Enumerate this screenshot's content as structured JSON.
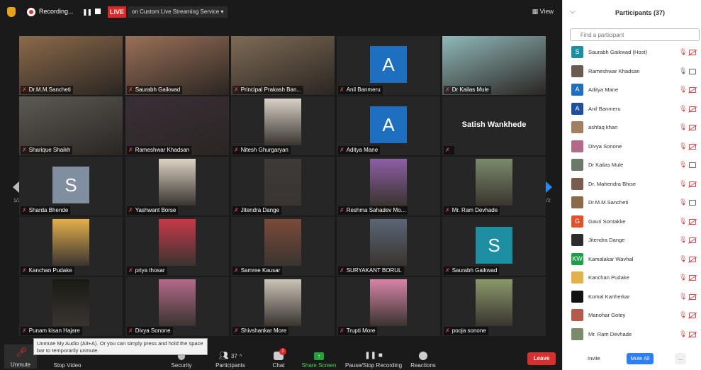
{
  "topbar": {
    "recording_label": "Recording...",
    "live_label": "LIVE",
    "live_destination": "on Custom Live Streaming Service",
    "view_label": "View"
  },
  "grid": {
    "page_indicator": "1/2",
    "tiles": [
      {
        "name": "Dr.M.M.Sancheti",
        "type": "video",
        "bg": "#8b6a4a"
      },
      {
        "name": "Saurabh Gaikwad",
        "type": "video",
        "bg": "#9a7058"
      },
      {
        "name": "Principal Prakash Ban...",
        "type": "video",
        "bg": "#7e6b55"
      },
      {
        "name": "Anil Banmeru",
        "type": "letter",
        "letter": "A",
        "color": "#1e6fbf"
      },
      {
        "name": "Dr Kailas Mule",
        "type": "video",
        "bg": "#8fb8b8"
      },
      {
        "name": "Sharique Shaikh",
        "type": "video",
        "bg": "#5c5a55"
      },
      {
        "name": "Rameshwar Khadsan",
        "type": "video",
        "bg": "#3a2f38",
        "active": true
      },
      {
        "name": "Nitesh Ghurgaryan",
        "type": "photo",
        "bg": "#d9d2c8"
      },
      {
        "name": "Aditya Mane",
        "type": "letter",
        "letter": "A",
        "color": "#1e6fbf"
      },
      {
        "name": "Satish Wankhede",
        "type": "text"
      },
      {
        "name": "Sharda Bhende",
        "type": "letter",
        "letter": "S",
        "color": "#7f8fa0"
      },
      {
        "name": "Yashwant Borse",
        "type": "photo",
        "bg": "#ddd3c5"
      },
      {
        "name": "Jitendra Dange",
        "type": "photo",
        "bg": "#3d3b3a"
      },
      {
        "name": "Reshma Sahadev Mo...",
        "type": "photo",
        "bg": "#8d5fa6"
      },
      {
        "name": "Mr. Ram Devhade",
        "type": "photo",
        "bg": "#7a8a6a"
      },
      {
        "name": "Kanchan Pudake",
        "type": "photo",
        "bg": "#e3b04a"
      },
      {
        "name": "priya thosar",
        "type": "photo",
        "bg": "#c8384a"
      },
      {
        "name": "Samree Kausar",
        "type": "photo",
        "bg": "#7b4a3a"
      },
      {
        "name": "SURYAKANT BORUL",
        "type": "photo",
        "bg": "#5a6575"
      },
      {
        "name": "Saurabh Gaikwad",
        "type": "letter",
        "letter": "S",
        "color": "#1d8fa3"
      },
      {
        "name": "Punam kisan Hajare",
        "type": "photo",
        "bg": "#1a1a14"
      },
      {
        "name": "Divya Sonone",
        "type": "photo",
        "bg": "#b36a8a"
      },
      {
        "name": "Shivshankar More",
        "type": "photo",
        "bg": "#c9c3b8"
      },
      {
        "name": "Trupti More",
        "type": "photo",
        "bg": "#d784a8"
      },
      {
        "name": "pooja sonone",
        "type": "photo",
        "bg": "#8a9a6a"
      }
    ]
  },
  "tooltip": {
    "text": "Unmute My Audio (Alt+A). Or you can simply press and hold the space bar to temporarily unmute."
  },
  "controls": {
    "unmute": "Unmute",
    "stop_video": "Stop Video",
    "security": "Security",
    "participants": "Participants",
    "participants_count": "37",
    "chat": "Chat",
    "chat_badge": "2",
    "share_screen": "Share Screen",
    "pause_stop_recording": "Pause/Stop Recording",
    "reactions": "Reactions",
    "leave": "Leave"
  },
  "panel": {
    "title": "Participants (37)",
    "search_placeholder": "Find a participant",
    "participants": [
      {
        "name": "Saurabh Gaikwad (Host)",
        "avatar": "S",
        "color": "#1d8fa3",
        "mic": "muted",
        "cam": "off"
      },
      {
        "name": "Rameshwar Khadsan",
        "avatar": "",
        "color": "#6a5a50",
        "mic": "on",
        "cam": "on"
      },
      {
        "name": "Aditya Mane",
        "avatar": "A",
        "color": "#1e6fbf",
        "mic": "muted",
        "cam": "off"
      },
      {
        "name": "Anil Banmeru",
        "avatar": "A",
        "color": "#1e4f9f",
        "mic": "muted",
        "cam": "off"
      },
      {
        "name": "ashfaq khan",
        "avatar": "",
        "color": "#a08060",
        "mic": "muted",
        "cam": "off"
      },
      {
        "name": "Divya Sonone",
        "avatar": "",
        "color": "#b36a8a",
        "mic": "muted",
        "cam": "off"
      },
      {
        "name": "Dr Kailas Mule",
        "avatar": "",
        "color": "#6a7a6a",
        "mic": "muted",
        "cam": "on"
      },
      {
        "name": "Dr. Mahendra Bhise",
        "avatar": "",
        "color": "#7a5a4a",
        "mic": "muted",
        "cam": "off"
      },
      {
        "name": "Dr.M.M.Sancheti",
        "avatar": "",
        "color": "#8b6a4a",
        "mic": "muted",
        "cam": "on"
      },
      {
        "name": "Gauri Sontakke",
        "avatar": "G",
        "color": "#e0522a",
        "mic": "muted",
        "cam": "off"
      },
      {
        "name": "Jitendra Dange",
        "avatar": "",
        "color": "#2d2d2d",
        "mic": "muted",
        "cam": "off"
      },
      {
        "name": "Kamalakar Wavhal",
        "avatar": "KW",
        "color": "#1f9e4a",
        "mic": "muted",
        "cam": "off"
      },
      {
        "name": "Kanchan Pudake",
        "avatar": "",
        "color": "#e3b04a",
        "mic": "muted",
        "cam": "off"
      },
      {
        "name": "Komal Kanherkar",
        "avatar": "",
        "color": "#111111",
        "mic": "muted",
        "cam": "off"
      },
      {
        "name": "Manohar Gotey",
        "avatar": "",
        "color": "#b35a4a",
        "mic": "muted",
        "cam": "off"
      },
      {
        "name": "Mr. Ram Devhade",
        "avatar": "",
        "color": "#7a8a6a",
        "mic": "muted",
        "cam": "off"
      }
    ],
    "invite": "Invite",
    "mute_all": "Mute All",
    "more": "..."
  }
}
